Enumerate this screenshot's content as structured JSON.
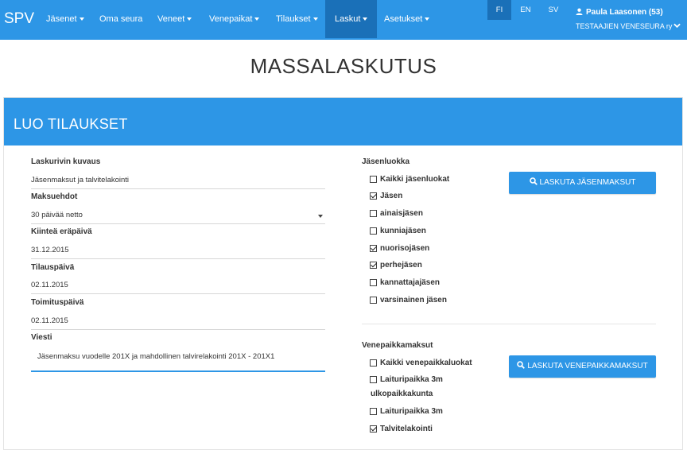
{
  "navbar": {
    "brand": "SPV",
    "items": [
      {
        "label": "Jäsenet",
        "dropdown": true
      },
      {
        "label": "Oma seura",
        "dropdown": false
      },
      {
        "label": "Veneet",
        "dropdown": true
      },
      {
        "label": "Venepaikat",
        "dropdown": true
      },
      {
        "label": "Tilaukset",
        "dropdown": true
      },
      {
        "label": "Laskut",
        "dropdown": true,
        "active": true
      },
      {
        "label": "Asetukset",
        "dropdown": true
      }
    ],
    "languages": [
      "FI",
      "EN",
      "SV"
    ],
    "active_language": "FI",
    "user_name": "Paula Laasonen (53)",
    "org_name": "TESTAAJIEN VENESEURA ry"
  },
  "page_title": "MASSALASKUTUS",
  "panel": {
    "title": "LUO TILAUKSET",
    "form": {
      "description_label": "Laskurivin kuvaus",
      "description_value": "Jäsenmaksut ja  talvitelakointi",
      "payment_terms_label": "Maksuehdot",
      "payment_terms_value": "30 päivää netto",
      "due_date_label": "Kiinteä eräpäivä",
      "due_date_value": "31.12.2015",
      "order_date_label": "Tilauspäivä",
      "order_date_value": "02.11.2015",
      "delivery_date_label": "Toimituspäivä",
      "delivery_date_value": "02.11.2015",
      "message_label": "Viesti",
      "message_value": "Jäsenmaksu vuodelle 201X ja mahdollinen talvirelakointi 201X - 201X1"
    },
    "member_classes": {
      "label": "Jäsenluokka",
      "options": [
        {
          "label": "Kaikki jäsenluokat",
          "checked": false
        },
        {
          "label": "Jäsen",
          "checked": true
        },
        {
          "label": "ainaisjäsen",
          "checked": false
        },
        {
          "label": "kunniajäsen",
          "checked": false
        },
        {
          "label": "nuorisojäsen",
          "checked": true
        },
        {
          "label": "perhejäsen",
          "checked": true
        },
        {
          "label": "kannattajajäsen",
          "checked": false
        },
        {
          "label": "varsinainen jäsen",
          "checked": false
        }
      ],
      "button_label": "LASKUTA JÄSENMAKSUT"
    },
    "berth_fees": {
      "label": "Venepaikkamaksut",
      "options": [
        {
          "label": "Kaikki venepaikkaluokat",
          "checked": false
        },
        {
          "label": "Laituripaikka 3m",
          "label_cont": "ulkopaikkakunta",
          "checked": false
        },
        {
          "label": "Laituripaikka 3m",
          "checked": false
        },
        {
          "label": "Talvitelakointi",
          "checked": true
        }
      ],
      "button_label": "LASKUTA VENEPAIKKAMAKSUT"
    }
  },
  "icons": {
    "user": "user-icon",
    "chevron": "chevron-down-icon",
    "search": "search-icon",
    "caret": "caret-down-icon"
  },
  "colors": {
    "primary": "#2d96e6",
    "primary_dark": "#1a70b8"
  }
}
